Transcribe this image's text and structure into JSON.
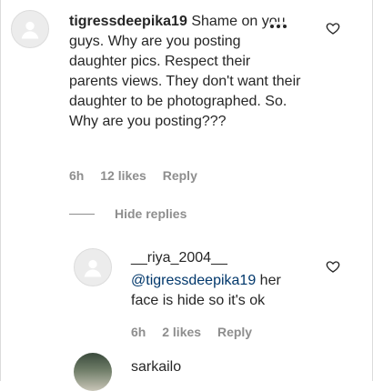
{
  "comment": {
    "username": "tigressdeepika19",
    "text": "Shame on you guys. Why are you posting daughter pics. Respect their parents views. They don't want their daughter to be photographed. So. Why are you posting???",
    "time": "6h",
    "likes": "12 likes",
    "reply_label": "Reply",
    "more_icon": "more-dots-icon",
    "like_icon": "heart-outline-icon"
  },
  "replies_toggle": {
    "label": "Hide replies"
  },
  "reply": {
    "username": "__riya_2004__",
    "mention": "@tigressdeepika19",
    "text": "her face is hide so it's ok",
    "time": "6h",
    "likes": "2 likes",
    "reply_label": "Reply",
    "like_icon": "heart-outline-icon"
  },
  "next_reply": {
    "username": "sarkailo"
  }
}
